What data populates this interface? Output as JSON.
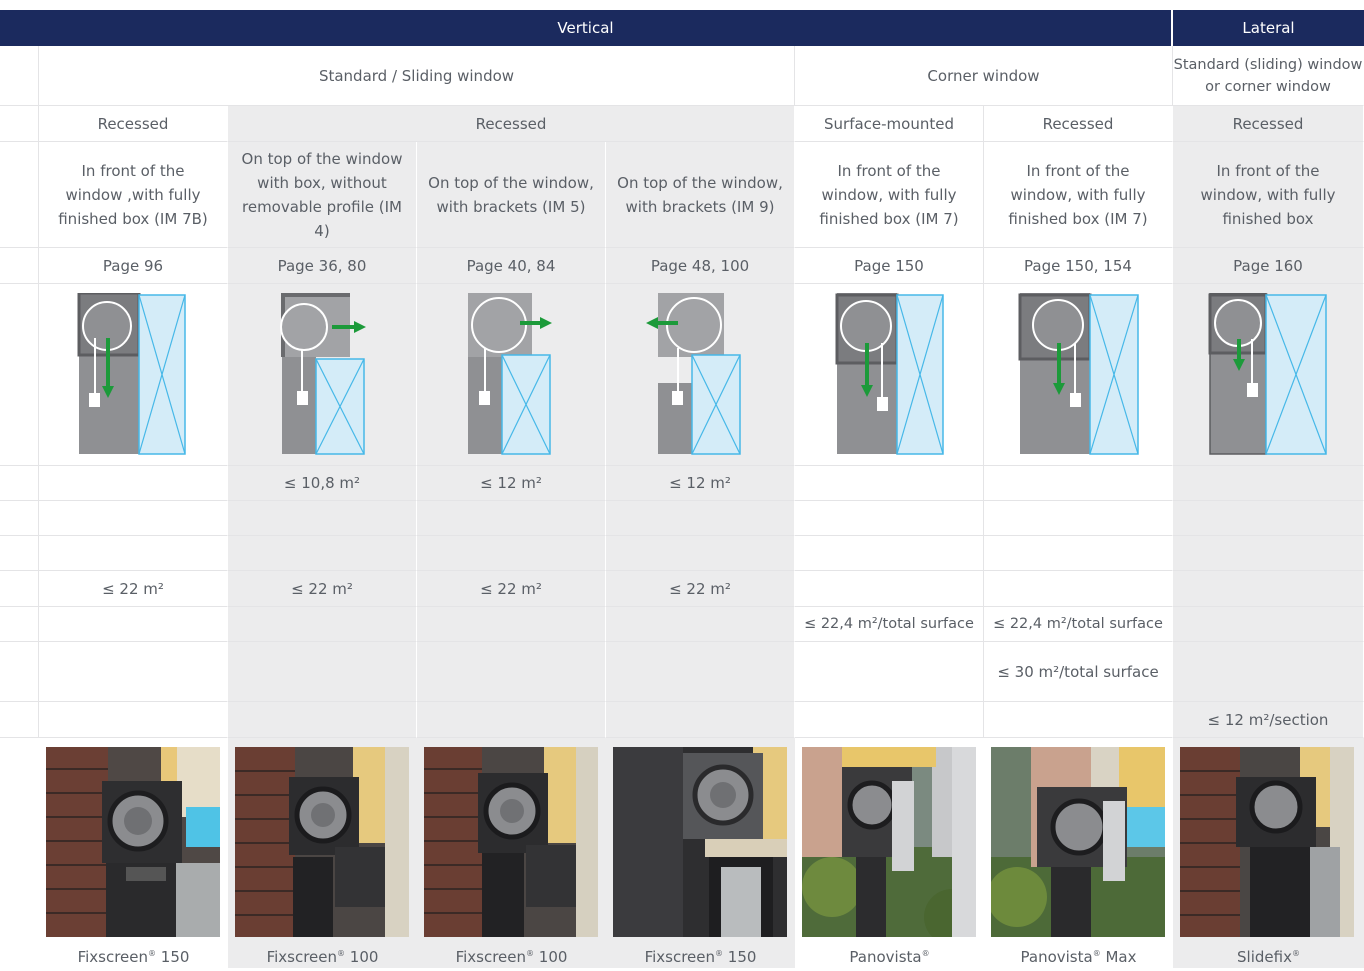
{
  "header": {
    "vertical": "Vertical",
    "lateral": "Lateral"
  },
  "window_type": {
    "standard_sliding": "Standard / Sliding window",
    "corner": "Corner window",
    "lateral": "Standard (sliding) window or corner window"
  },
  "mounting": {
    "c1": "Recessed",
    "c2to4": "Recessed",
    "c5": "Surface-mounted",
    "c6": "Recessed",
    "c7": "Recessed"
  },
  "description": [
    "In front of  the window ,with fully finished box (IM 7B)",
    "On top of the window with box, without removable profile (IM 4)",
    "On top of the window, with brackets (IM 5)",
    "On top of the window, with brackets (IM 9)",
    "In front of the window, with fully finished box (IM 7)",
    "In front of the window, with fully finished box (IM 7)",
    "In front of the window, with fully finished box"
  ],
  "pages": [
    "Page 96",
    "Page 36, 80",
    "Page 40, 84",
    "Page 48, 100",
    "Page 150",
    "Page 150, 154",
    "Page 160"
  ],
  "row_size_1": {
    "c2": "≤ 10,8 m²",
    "c3": "≤ 12 m²",
    "c4": "≤ 12 m²"
  },
  "row_size_4": {
    "c1": "≤ 22 m²",
    "c2": "≤ 22 m²",
    "c3": "≤ 22 m²",
    "c4": "≤ 22 m²"
  },
  "row_size_5": {
    "c5": "≤ 22,4 m²/total surface",
    "c6": "≤ 22,4 m²/total surface"
  },
  "row_size_6": {
    "c6": "≤ 30 m²/total surface"
  },
  "row_size_7": {
    "c7": "≤ 12 m²/section"
  },
  "products": [
    {
      "name": "Fixscreen",
      "reg": "®",
      "suffix": " 150"
    },
    {
      "name": "Fixscreen",
      "reg": "®",
      "suffix": " 100"
    },
    {
      "name": "Fixscreen",
      "reg": "®",
      "suffix": " 100"
    },
    {
      "name": "Fixscreen",
      "reg": "®",
      "suffix": " 150"
    },
    {
      "name": "Panovista",
      "reg": "®",
      "suffix": ""
    },
    {
      "name": "Panovista",
      "reg": "®",
      "suffix": " Max"
    },
    {
      "name": "Slidefix",
      "reg": "®",
      "suffix": ""
    }
  ],
  "colors": {
    "header_bg": "#1b2a5e",
    "gray_cell": "#ececed",
    "arrow": "#1c9a3a",
    "glass": "#d4ecf8",
    "glass_line": "#46b8e8"
  }
}
